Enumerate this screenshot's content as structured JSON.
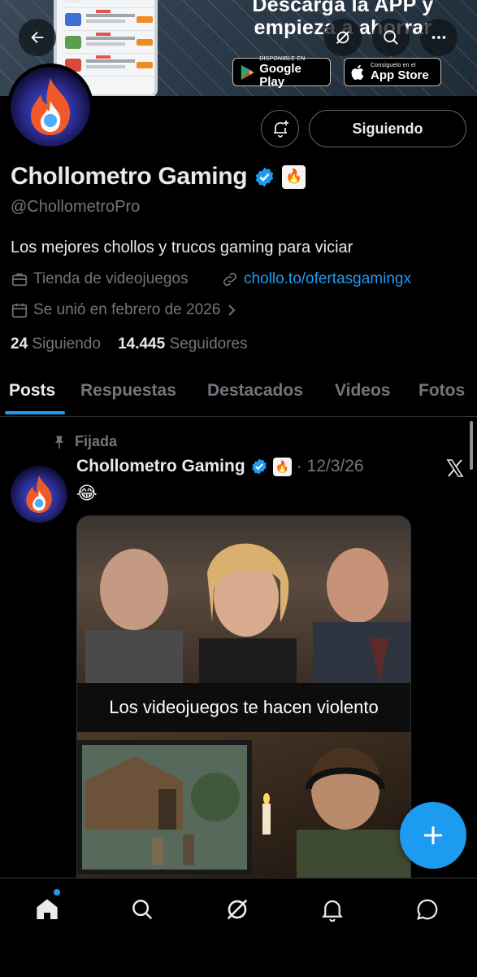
{
  "banner": {
    "headline": "Descarga la APP y empieza a ahorrar",
    "google_play_small": "DISPONIBLE EN",
    "google_play_big": "Google Play",
    "app_store_small": "Consíguelo en el",
    "app_store_big": "App Store"
  },
  "header_icons": [
    "back-arrow-icon",
    "grok-icon",
    "search-icon",
    "more-icon"
  ],
  "profile": {
    "name": "Chollometro Gaming",
    "handle": "@ChollometroPro",
    "bio": "Los mejores chollos y trucos gaming para viciar",
    "category": "Tienda de videojuegos",
    "link": "chollo.to/ofertasgamingx",
    "joined": "Se unió en febrero de 2026",
    "following_count": "24",
    "following_label": "Siguiendo",
    "followers_count": "14.445",
    "followers_label": "Seguidores",
    "follow_button": "Siguiendo",
    "badge_emoji": "🔥"
  },
  "tabs": [
    {
      "label": "Posts",
      "active": true
    },
    {
      "label": "Respuestas",
      "active": false
    },
    {
      "label": "Destacados",
      "active": false
    },
    {
      "label": "Videos",
      "active": false
    },
    {
      "label": "Fotos",
      "active": false
    }
  ],
  "post": {
    "pinned_label": "Fijada",
    "author": "Chollometro Gaming",
    "date": "· 12/3/26",
    "text": "😂",
    "media_caption": "Los videojuegos te hacen violento"
  },
  "bottom_nav": [
    "home-icon",
    "search-icon",
    "grok-icon",
    "notifications-icon",
    "messages-icon"
  ],
  "colors": {
    "accent": "#1d9bf0",
    "background": "#000000",
    "muted": "#71767b"
  }
}
